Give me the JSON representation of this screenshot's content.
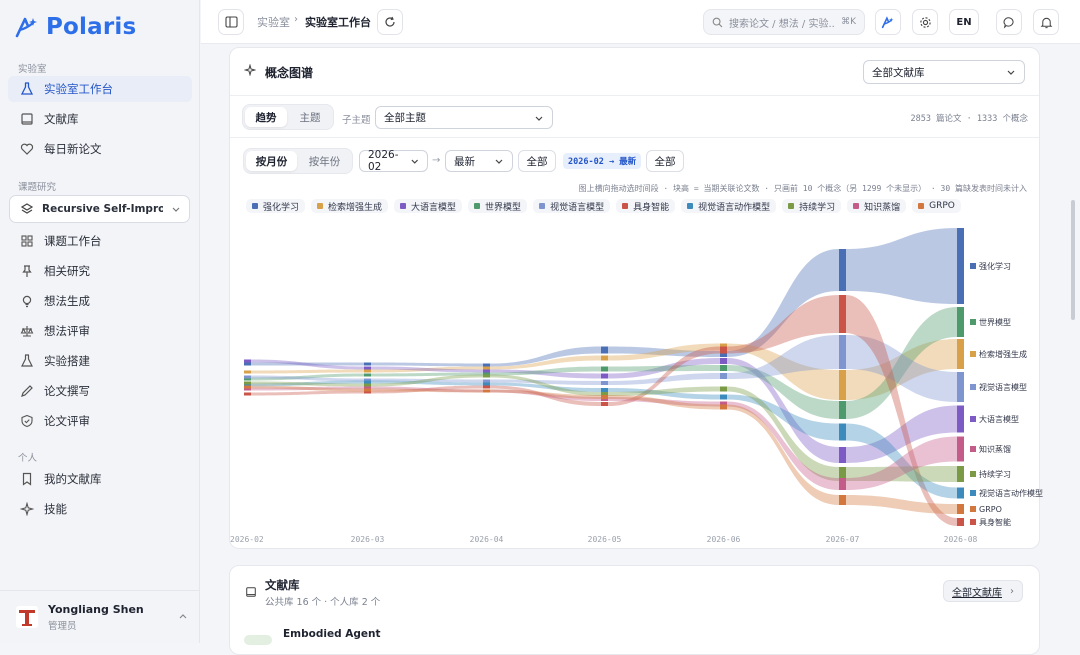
{
  "app": {
    "name": "Polaris"
  },
  "sidebar": {
    "section_lab": "实验室",
    "lab_items": [
      {
        "label": "实验室工作台",
        "icon": "flask-icon"
      },
      {
        "label": "文献库",
        "icon": "book-icon"
      },
      {
        "label": "每日新论文",
        "icon": "heart-icon"
      }
    ],
    "section_project": "课题研究",
    "project": "Recursive Self-Improvement",
    "project_items": [
      {
        "label": "课题工作台",
        "icon": "grid-icon"
      },
      {
        "label": "相关研究",
        "icon": "pin-icon"
      },
      {
        "label": "想法生成",
        "icon": "bulb-icon"
      },
      {
        "label": "想法评审",
        "icon": "scale-icon"
      },
      {
        "label": "实验搭建",
        "icon": "flask-icon"
      },
      {
        "label": "论文撰写",
        "icon": "pen-icon"
      },
      {
        "label": "论文评审",
        "icon": "shield-check-icon"
      }
    ],
    "section_personal": "个人",
    "personal_items": [
      {
        "label": "我的文献库",
        "icon": "bookmark-icon"
      },
      {
        "label": "技能",
        "icon": "sparkle-icon"
      }
    ],
    "user": {
      "name": "Yongliang Shen",
      "role": "管理员"
    }
  },
  "topbar": {
    "crumb_parent": "实验室",
    "crumb_current": "实验室工作台",
    "search_placeholder": "搜索论文 / 想法 / 实验...",
    "search_shortcut": "⌘K",
    "lang": "EN"
  },
  "concept_map": {
    "title": "概念图谱",
    "scope_select": "全部文献库",
    "tabs": [
      "趋势",
      "主题"
    ],
    "active_tab": "趋势",
    "subtopic_label": "子主题",
    "subtopic_select": "全部主题",
    "stats": "2853 篇论文 · 1333 个概念",
    "granularity": [
      "按月份",
      "按年份"
    ],
    "from": "2026-02",
    "to": "最新",
    "all_btn": "全部",
    "range_badge": "2026-02 → 最新",
    "all_btn2": "全部",
    "hint": "图上横向拖动选时间段 · 块高 = 当期关联论文数 · 只画前 10 个概念（另 1299 个未显示） · 30 篇缺发表时间未计入"
  },
  "chart_data": {
    "type": "area",
    "chart_form": "bump/stream (alluvial ribbons)",
    "x": [
      "2026-02",
      "2026-03",
      "2026-04",
      "2026-05",
      "2026-06",
      "2026-07",
      "2026-08"
    ],
    "series": [
      {
        "name": "强化学习",
        "color": "#4a6fb5"
      },
      {
        "name": "检索增强生成",
        "color": "#d9a04a"
      },
      {
        "name": "大语言模型",
        "color": "#7c5cc4"
      },
      {
        "name": "世界模型",
        "color": "#4e9a6c"
      },
      {
        "name": "视觉语言模型",
        "color": "#7f95cf"
      },
      {
        "name": "具身智能",
        "color": "#c95447"
      },
      {
        "name": "视觉语言动作模型",
        "color": "#3d8bbd"
      },
      {
        "name": "持续学习",
        "color": "#7a9a45"
      },
      {
        "name": "知识蒸馏",
        "color": "#c45c8a"
      },
      {
        "name": "GRPO",
        "color": "#d2783f"
      }
    ],
    "end_labels": [
      "强化学习",
      "世界模型",
      "检索增强生成",
      "视觉语言模型",
      "大语言模型",
      "知识蒸馏",
      "持续学习",
      "视觉语言动作模型",
      "GRPO",
      "具身智能"
    ]
  },
  "library": {
    "title": "文献库",
    "subtitle": "公共库 16 个 · 个人库 2 个",
    "button": "全部文献库",
    "first_item": "Embodied Agent"
  }
}
